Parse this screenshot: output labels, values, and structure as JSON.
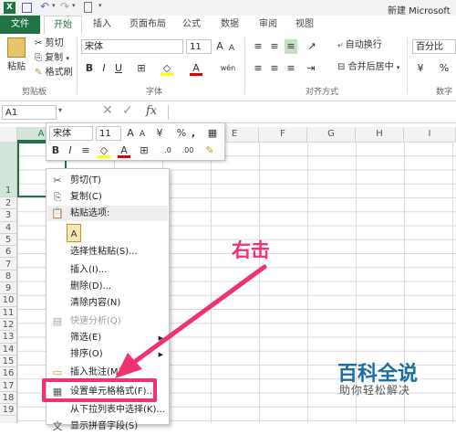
{
  "window": {
    "title": "新建 Microsoft E"
  },
  "tabs": [
    {
      "id": "file",
      "label": "文件"
    },
    {
      "id": "home",
      "label": "开始"
    },
    {
      "id": "insert",
      "label": "插入"
    },
    {
      "id": "layout",
      "label": "页面布局"
    },
    {
      "id": "formulas",
      "label": "公式"
    },
    {
      "id": "data",
      "label": "数据"
    },
    {
      "id": "review",
      "label": "审阅"
    },
    {
      "id": "view",
      "label": "视图"
    }
  ],
  "ribbon": {
    "clipboard": {
      "paste": "粘贴",
      "cut": "剪切",
      "copy": "复制",
      "format_painter": "格式刷",
      "label": "剪贴板"
    },
    "font": {
      "name": "宋体",
      "size": "11",
      "label": "字体",
      "bold": "B",
      "italic": "I",
      "underline": "U",
      "grow": "A",
      "shrink": "A",
      "color_a": "A",
      "phonetic": "wén"
    },
    "alignment": {
      "wrap": "自动换行",
      "merge": "合并后居中",
      "label": "对齐方式"
    },
    "number": {
      "format": "百分比",
      "label": "数字",
      "percent": "%"
    }
  },
  "formula_bar": {
    "name_box": "A1",
    "fx": "fx"
  },
  "columns": [
    "A",
    "B",
    "C",
    "D",
    "E",
    "F",
    "G",
    "H",
    "I"
  ],
  "rows": [
    "1",
    "2",
    "3",
    "4",
    "5",
    "6",
    "7",
    "8",
    "9",
    "10",
    "11",
    "12",
    "13",
    "14",
    "15",
    "16",
    "17",
    "18",
    "19"
  ],
  "mini_toolbar": {
    "font": "宋体",
    "size": "11",
    "bold": "B",
    "italic": "I",
    "percent": "%",
    "comma": ","
  },
  "context_menu": {
    "cut": "剪切(T)",
    "copy": "复制(C)",
    "paste_options": "粘贴选项:",
    "paste_special": "选择性粘贴(S)...",
    "insert": "插入(I)...",
    "delete": "删除(D)...",
    "clear": "清除内容(N)",
    "quick_analysis": "快速分析(Q)",
    "filter": "筛选(E)",
    "sort": "排序(O)",
    "insert_comment": "插入批注(M)",
    "format_cells": "设置单元格格式(F)...",
    "pick_list": "从下拉列表中选择(K)...",
    "phonetic": "显示拼音字段(S)"
  },
  "annotation": {
    "text": "右击"
  },
  "watermark": {
    "title": "百科全说",
    "subtitle": "助你轻松解决"
  },
  "colors": {
    "excel_green": "#217346",
    "annotation_pink": "#f0326e",
    "watermark_blue": "#1a6ea8"
  }
}
